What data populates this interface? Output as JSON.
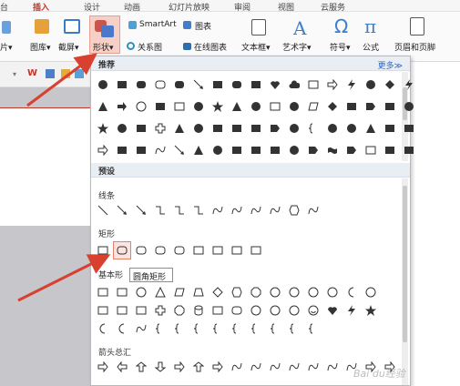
{
  "tabs": [
    {
      "label": "台",
      "active": false
    },
    {
      "label": "插入",
      "active": true
    },
    {
      "label": "设计",
      "active": false
    },
    {
      "label": "动画",
      "active": false
    },
    {
      "label": "幻灯片放映",
      "active": false
    },
    {
      "label": "审阅",
      "active": false
    },
    {
      "label": "视图",
      "active": false
    },
    {
      "label": "云服务",
      "active": false
    }
  ],
  "ribbon": {
    "picture": "片▾",
    "gallery": "图库▾",
    "screenshot": "截屏▾",
    "shapes": "形状▾",
    "smartart": "SmartArt",
    "chart": "图表",
    "relation": "关系图",
    "online_chart": "在线图表",
    "textbox": "文本框▾",
    "wordart": "艺术字▾",
    "symbol": "符号▾",
    "formula": "公式",
    "header_footer": "页眉和页脚"
  },
  "toolbar2": {
    "letter": "W"
  },
  "shapes_panel": {
    "recommend_label": "推荐",
    "more_label": "更多≫",
    "preset_label": "预设",
    "categories": {
      "lines": "线条",
      "rect": "矩形",
      "basic": "基本形",
      "arrows": "箭头总汇"
    },
    "tooltip": "圆角矩形"
  },
  "accent": "#c0392b",
  "watermark": "Bai du经验"
}
